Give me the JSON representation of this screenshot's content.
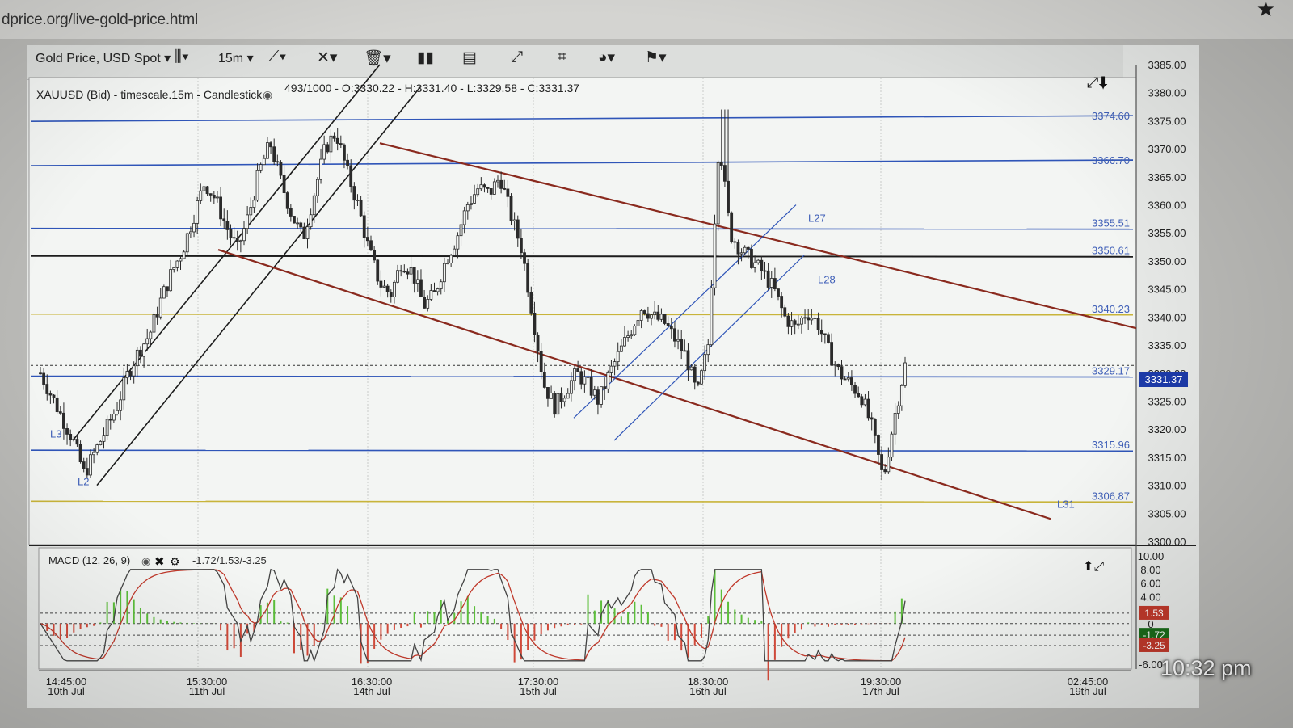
{
  "browser": {
    "url": "dprice.org/live-gold-price.html"
  },
  "toolbar": {
    "instrument_select": "Gold Price, USD Spot",
    "timeframe_select": "15m",
    "icons": [
      "candlestick-type-icon",
      "draw-line-icon",
      "cross-tool-icon",
      "trash-icon",
      "volume-bars-icon",
      "layout-icon",
      "fullscreen-icon",
      "crop-icon",
      "theme-icon",
      "flag-uk-icon"
    ]
  },
  "main_chart": {
    "header": "XAUUSD (Bid) - timescale.15m - Candlestick",
    "header_stats": "493/1000 - O:3330.22 - H:3331.40 - L:3329.58 - C:3331.37"
  },
  "macd_panel": {
    "header": "MACD (12, 26, 9)",
    "header_values": "-1.72/1.53/-3.25"
  },
  "status": {
    "time": "10:32 pm"
  },
  "colors": {
    "hline_blue": "#2f55b8",
    "hline_gold": "#c8b43a",
    "channel_brown": "#8a2a1e",
    "trend_black": "#1c1c1c",
    "candles": "#2a2a2a",
    "macd_fast": "#444444",
    "macd_signal": "#c0392b",
    "hist_pos": "#5cbf3a",
    "hist_neg": "#d24a3a",
    "price_tag_bg": "#1c3aa8"
  },
  "chart_data": {
    "type": "candlestick",
    "symbol": "XAUUSD",
    "timeframe": "15m",
    "ylim": [
      3300,
      3385
    ],
    "y_tick_labels": [
      "3385.00",
      "3380.00",
      "3375.00",
      "3370.00",
      "3365.00",
      "3360.00",
      "3355.00",
      "3350.00",
      "3345.00",
      "3340.00",
      "3335.00",
      "3330.00",
      "3325.00",
      "3320.00",
      "3315.00",
      "3310.00",
      "3305.00",
      "3300.00"
    ],
    "x_tick_labels": [
      {
        "time": "14:45:00",
        "date": "10th Jul"
      },
      {
        "time": "15:30:00",
        "date": "11th Jul"
      },
      {
        "time": "16:30:00",
        "date": "14th Jul"
      },
      {
        "time": "17:30:00",
        "date": "15th Jul"
      },
      {
        "time": "18:30:00",
        "date": "16th Jul"
      },
      {
        "time": "19:30:00",
        "date": "17th Jul"
      },
      {
        "time": "02:45:00",
        "date": "19th Jul"
      }
    ],
    "current_price": 3331.37,
    "current_price_label": "3331.37",
    "horizontal_levels": [
      {
        "value": 3374.6,
        "label": "3374.60",
        "color": "blue"
      },
      {
        "value": 3366.7,
        "label": "3366.70",
        "color": "blue"
      },
      {
        "value": 3355.51,
        "label": "3355.51",
        "color": "blue"
      },
      {
        "value": 3350.61,
        "label": "3350.61",
        "color": "black"
      },
      {
        "value": 3340.23,
        "label": "3340.23",
        "color": "gold"
      },
      {
        "value": 3329.17,
        "label": "3329.17",
        "color": "blue"
      },
      {
        "value": 3315.96,
        "label": "3315.96",
        "color": "blue"
      },
      {
        "value": 3306.87,
        "label": "3306.87",
        "color": "gold"
      }
    ],
    "line_labels": [
      "L3",
      "L2",
      "L27",
      "L28",
      "L31"
    ],
    "price_path": [
      3330,
      3326,
      3322,
      3318,
      3312,
      3316,
      3320,
      3324,
      3330,
      3334,
      3337,
      3343,
      3348,
      3352,
      3358,
      3364,
      3361,
      3356,
      3352,
      3358,
      3366,
      3371,
      3364,
      3358,
      3354,
      3362,
      3370,
      3373,
      3366,
      3360,
      3352,
      3346,
      3344,
      3350,
      3348,
      3342,
      3344,
      3350,
      3354,
      3360,
      3363,
      3362,
      3365,
      3358,
      3352,
      3340,
      3328,
      3324,
      3327,
      3330,
      3328,
      3325,
      3330,
      3334,
      3338,
      3342,
      3340,
      3339,
      3336,
      3333,
      3326,
      3335,
      3372,
      3355,
      3352,
      3350,
      3348,
      3345,
      3340,
      3338,
      3341,
      3339,
      3334,
      3330,
      3328,
      3326,
      3320,
      3311,
      3322,
      3331.37
    ],
    "macd": {
      "fast": -1.72,
      "signal": 1.53,
      "histogram": -3.25,
      "y_tick_labels": [
        "10.00",
        "8.00",
        "6.00",
        "4.00",
        "0",
        "-6.00"
      ],
      "value_labels": [
        {
          "value": 1.53,
          "label": "1.53",
          "color": "#c0392b"
        },
        {
          "value": -1.72,
          "label": "-1.72",
          "color": "#1a6b1a"
        },
        {
          "value": -3.25,
          "label": "-3.25",
          "color": "#c0392b"
        }
      ]
    }
  }
}
